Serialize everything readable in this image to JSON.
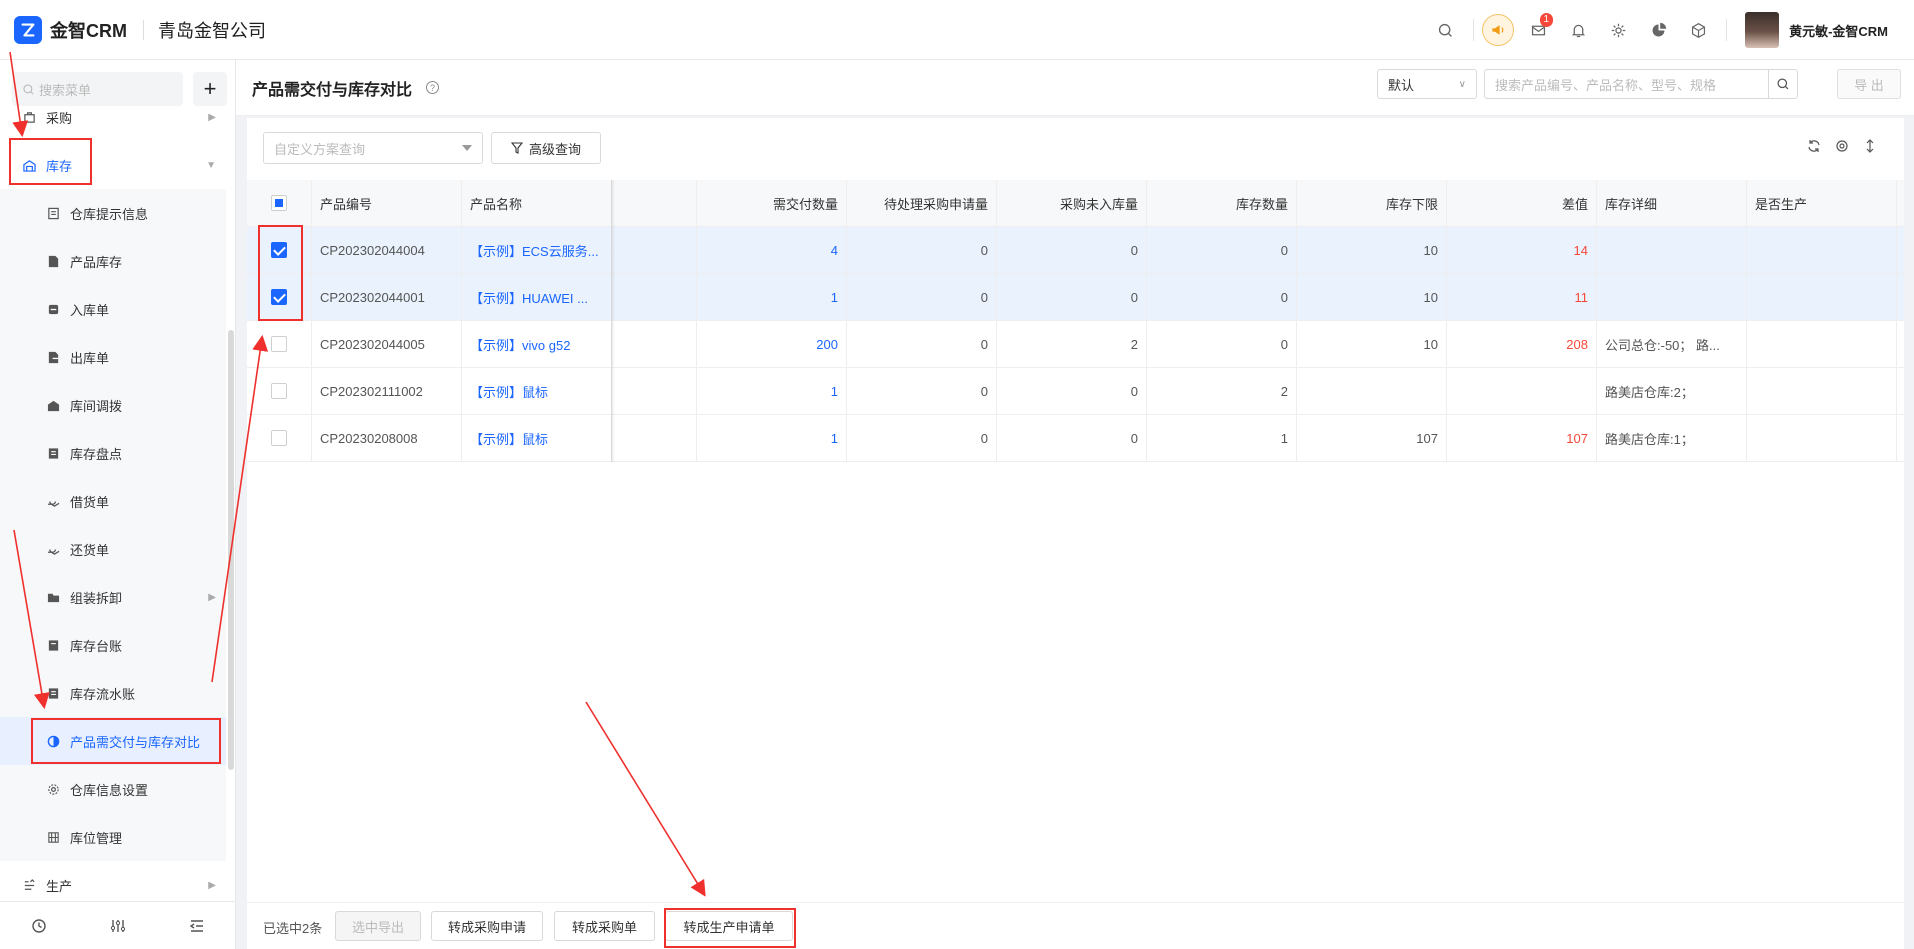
{
  "app": {
    "logo_text": "金智CRM",
    "company": "青岛金智公司",
    "user_name": "黄元敏-金智CRM",
    "notification_count": "1"
  },
  "sidebar": {
    "search_placeholder": "搜索菜单",
    "add_label": "+",
    "items": [
      {
        "label": "采购",
        "icon": "purchase-icon"
      },
      {
        "label": "库存",
        "icon": "warehouse-icon"
      },
      {
        "label": "仓库提示信息",
        "icon": "doc-icon"
      },
      {
        "label": "产品库存",
        "icon": "file-icon"
      },
      {
        "label": "入库单",
        "icon": "inbound-icon"
      },
      {
        "label": "出库单",
        "icon": "outbound-icon"
      },
      {
        "label": "库间调拨",
        "icon": "transfer-icon"
      },
      {
        "label": "库存盘点",
        "icon": "inventory-icon"
      },
      {
        "label": "借货单",
        "icon": "borrow-icon"
      },
      {
        "label": "还货单",
        "icon": "return-icon"
      },
      {
        "label": "组装拆卸",
        "icon": "folder-icon"
      },
      {
        "label": "库存台账",
        "icon": "ledger-icon"
      },
      {
        "label": "库存流水账",
        "icon": "flow-icon"
      },
      {
        "label": "产品需交付与库存对比",
        "icon": "half-circle-icon"
      },
      {
        "label": "仓库信息设置",
        "icon": "settings-icon"
      },
      {
        "label": "库位管理",
        "icon": "grid-icon"
      },
      {
        "label": "生产",
        "icon": "production-icon"
      }
    ]
  },
  "page": {
    "title": "产品需交付与库存对比",
    "sort_select": "默认",
    "search_placeholder": "搜索产品编号、产品名称、型号、规格",
    "export_label": "导 出",
    "scheme_placeholder": "自定义方案查询",
    "advanced_query": "高级查询"
  },
  "table": {
    "columns": [
      "产品编号",
      "产品名称",
      "需交付数量",
      "待处理采购申请量",
      "采购未入库量",
      "库存数量",
      "库存下限",
      "差值",
      "库存详细",
      "是否生产"
    ],
    "rows": [
      {
        "checked": true,
        "code": "CP202302044004",
        "name": "【示例】ECS云服务...",
        "deliver": "4",
        "pending": "0",
        "not_in": "0",
        "stock": "0",
        "min": "10",
        "diff": "14",
        "detail": "",
        "produce": ""
      },
      {
        "checked": true,
        "code": "CP202302044001",
        "name": "【示例】HUAWEI ...",
        "deliver": "1",
        "pending": "0",
        "not_in": "0",
        "stock": "0",
        "min": "10",
        "diff": "11",
        "detail": "",
        "produce": ""
      },
      {
        "checked": false,
        "code": "CP202302044005",
        "name": "【示例】vivo g52",
        "deliver": "200",
        "pending": "0",
        "not_in": "2",
        "stock": "0",
        "min": "10",
        "diff": "208",
        "detail": "公司总仓:-50；  路...",
        "produce": ""
      },
      {
        "checked": false,
        "code": "CP202302111002",
        "name": "【示例】鼠标",
        "deliver": "1",
        "pending": "0",
        "not_in": "0",
        "stock": "2",
        "min": "",
        "diff": "",
        "detail": "路美店仓库:2；",
        "produce": ""
      },
      {
        "checked": false,
        "code": "CP20230208008",
        "name": "【示例】鼠标",
        "deliver": "1",
        "pending": "0",
        "not_in": "0",
        "stock": "1",
        "min": "107",
        "diff": "107",
        "detail": "路美店仓库:1；",
        "produce": ""
      }
    ]
  },
  "footer": {
    "selected_text": "已选中2条",
    "export_selected": "选中导出",
    "to_purchase_request": "转成采购申请",
    "to_purchase_order": "转成采购单",
    "to_production_request": "转成生产申请单"
  },
  "colors": {
    "accent": "#1a66ff",
    "danger": "#f5483b",
    "annotation": "#f0302d"
  }
}
